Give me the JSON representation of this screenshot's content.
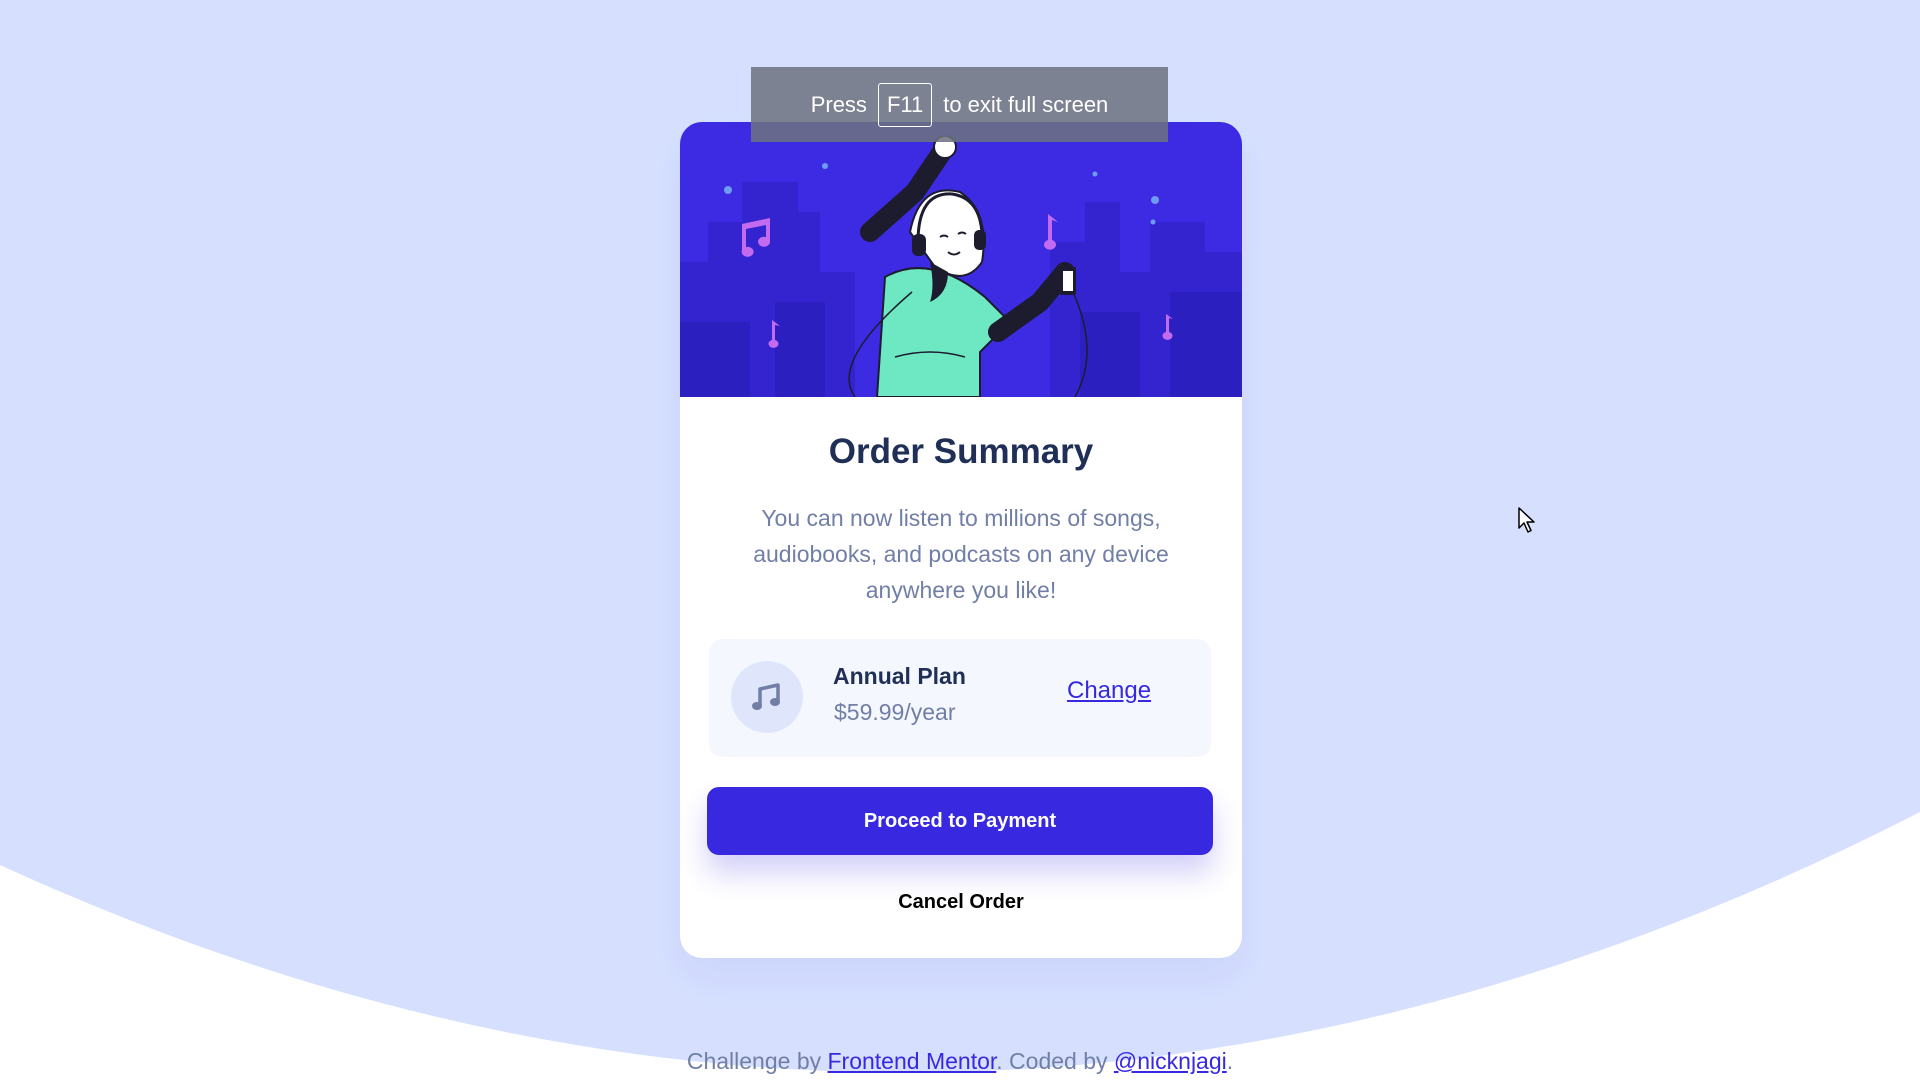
{
  "fullscreen_notice": {
    "press_text": "Press",
    "key_label": "F11",
    "suffix_text": "to exit full screen"
  },
  "card": {
    "title": "Order Summary",
    "description": "You can now listen to millions of songs, audiobooks, and podcasts on any device anywhere you like!",
    "plan": {
      "name": "Annual Plan",
      "price": "$59.99/year",
      "change_label": "Change",
      "icon": "music-note-icon"
    },
    "proceed_label": "Proceed to Payment",
    "cancel_label": "Cancel Order"
  },
  "footer": {
    "challenge_prefix": "Challenge by",
    "challenge_link": "Frontend Mentor",
    "coded_prefix": ". Coded by",
    "author_link": "@nicknjagi",
    "suffix": "."
  },
  "colors": {
    "background": "#d6e0fe",
    "accent": "#3829e0",
    "heading": "#1f2f56",
    "muted_text": "#717fa6",
    "plan_background": "#f5f7ff"
  }
}
